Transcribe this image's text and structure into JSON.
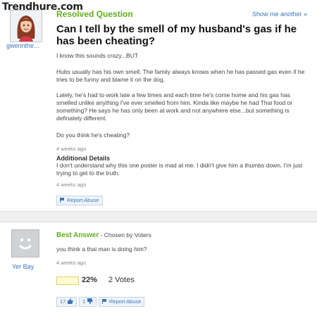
{
  "watermark": "Trendhure.com",
  "question": {
    "status_label": "Resolved Question",
    "show_more": "Show me another »",
    "asker": "gwennthe...",
    "title": "Can I tell by the smell of my husband's gas if he has been cheating?",
    "paragraphs": [
      "I know this sounds crazy...BUT",
      "Hubs usually has his own smell. The family always knows when he has passed gas even if he tries to be funny and blame it on the dog.",
      "Lately, he's had to work late a few times and each time he's come home and his gas has smelled unlike anything I've ever smelled from him. Kinda like maybe he had Thai food or something? He says he has only been at work and not anywhere else...but something is definately different.",
      "Do you think he's cheating?"
    ],
    "time": "4 weeks ago",
    "additional_title": "Additional Details",
    "additional_text": "I don't understand why this one poster is mad at me. I didn't give him a thumbs down. I'm just trying to get to the truth.",
    "additional_time": "4 weeks ago",
    "report_label": "Report Abuse"
  },
  "answer": {
    "answerer": "Yer Bay",
    "best_label": "Best Answer",
    "chosen_label": " - Chosen by Voters",
    "text": "you think a thai man is doing him?",
    "time": "4 weeks ago",
    "vote_percent": "22%",
    "vote_fraction": 0.22,
    "votes_label": "2 Votes",
    "thumbs_up": "17",
    "thumbs_down": "1",
    "report_label": "Report Abuse"
  },
  "colors": {
    "accent_green": "#5fae1c",
    "link_blue": "#3b76b8"
  }
}
